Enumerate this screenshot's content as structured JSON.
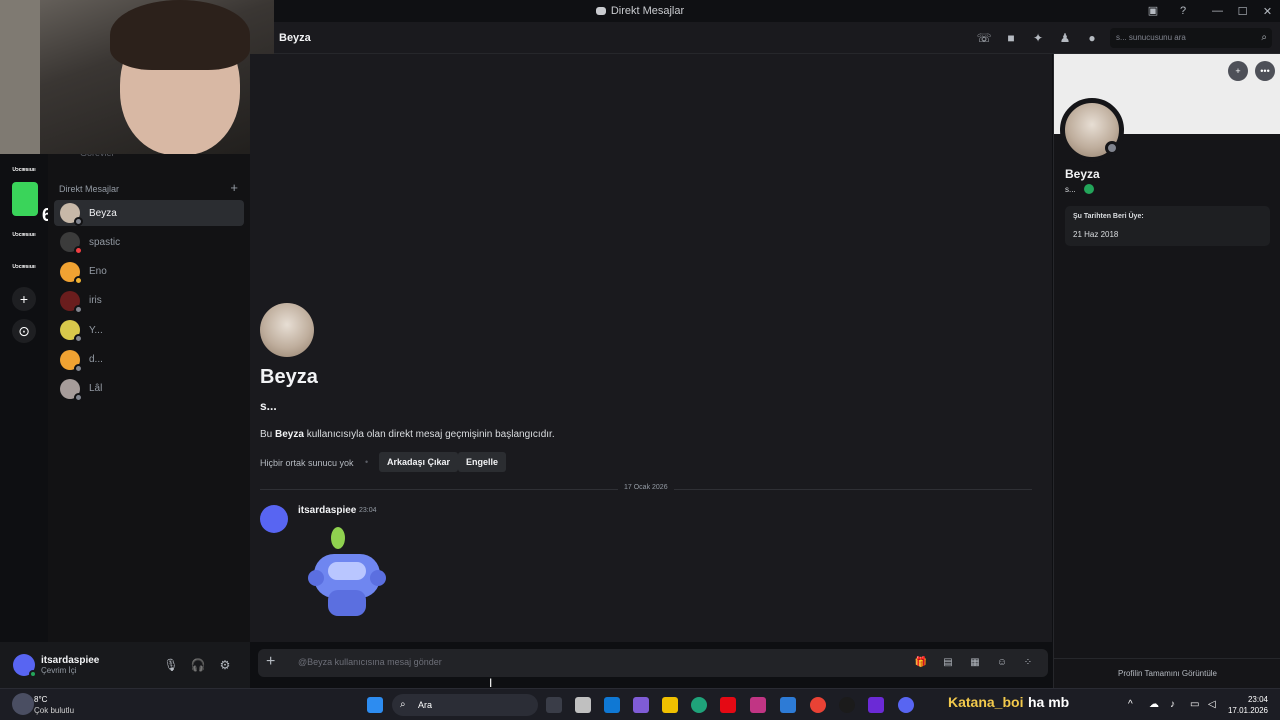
{
  "window": {
    "title": "Direkt Mesajlar",
    "controls": {
      "minimize": "—",
      "maximize": "☐",
      "close": "✕"
    }
  },
  "rail": {
    "servers": [
      "Uɔcıɐsıuıı",
      "Uɔcıɐsıuıı",
      "Uɔcıɐsıuıı",
      "Uɔcıɐsıuıı"
    ],
    "badge": "6",
    "add_label": "+",
    "explore_label": "⊙"
  },
  "sidebar": {
    "faded_item": "Görevler",
    "section_title": "Direkt Mesajlar",
    "add_label": "+",
    "dms": [
      {
        "name": "Beyza",
        "color": "#c7b8a8",
        "status": "#80848e"
      },
      {
        "name": "spastic",
        "color": "#3b3b3b",
        "status": "#f23f43"
      },
      {
        "name": "Eno",
        "color": "#f0a232",
        "status": "#f0b232"
      },
      {
        "name": "iris",
        "color": "#6a1d1d",
        "status": "#80848e"
      },
      {
        "name": "Y...",
        "color": "#d8c84b",
        "status": "#80848e"
      },
      {
        "name": "d...",
        "color": "#f0a232",
        "status": "#80848e"
      },
      {
        "name": "Lâl",
        "color": "#a69c9a",
        "status": "#80848e"
      }
    ]
  },
  "user": {
    "name": "itsardaspiee",
    "status": "Çevrim İçi"
  },
  "header": {
    "name": "Beyza",
    "search_placeholder": "s... sunucusunu ara"
  },
  "chat": {
    "name": "Beyza",
    "short": "s...",
    "intro_pre": "Bu ",
    "intro_name": "Beyza",
    "intro_post": " kullanıcısıyla olan direkt mesaj geçmişinin başlangıcıdır.",
    "no_common": "Hiçbir ortak sunucu yok",
    "dot": "•",
    "remove_friend": "Arkadaşı Çıkar",
    "block": "Engelle",
    "date": "17 Ocak 2026",
    "message": {
      "author": "itsardaspiee",
      "time": "23:04"
    }
  },
  "composer": {
    "add_label": "+",
    "placeholder": "@Beyza kullanıcısına mesaj gönder"
  },
  "profile": {
    "name": "Beyza",
    "short": "s...",
    "member_since_label": "Şu Tarihten Beri Üye:",
    "member_since": "21 Haz 2018",
    "view_full": "Profilin Tamamını Görüntüle"
  },
  "taskbar": {
    "temp": "8°C",
    "weather": "Çok bulutlu",
    "search": "Ara",
    "stream_name": "Katana_boi",
    "stream_text": "ha mb",
    "time": "23:04",
    "date": "17.01.2026"
  },
  "colors": {
    "blurple": "#5865f2",
    "online": "#23a55a"
  }
}
